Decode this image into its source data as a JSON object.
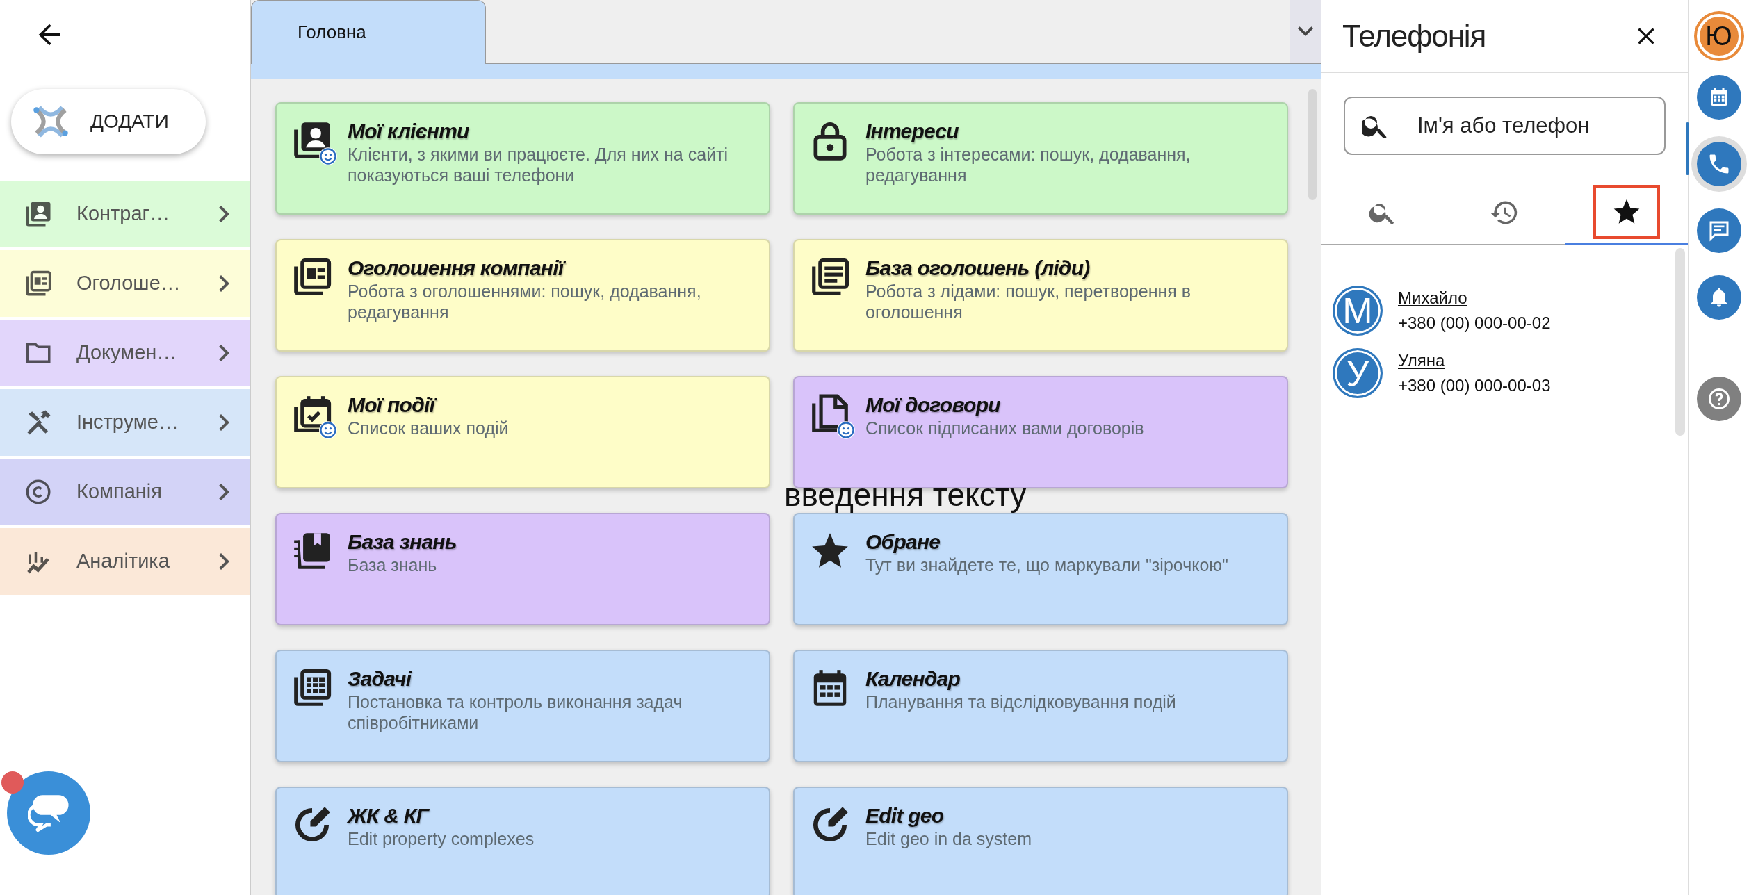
{
  "sidebar": {
    "add_button": "ДОДАТИ",
    "items": [
      {
        "label": "Контраг…",
        "kind": "contacts",
        "color": "#dbfbd8"
      },
      {
        "label": "Оголоше…",
        "kind": "ads",
        "color": "#fdfdd8"
      },
      {
        "label": "Докумен…",
        "kind": "folder",
        "color": "#e2d6fb"
      },
      {
        "label": "Інструме…",
        "kind": "tools",
        "color": "#d6e6f9"
      },
      {
        "label": "Компанія",
        "kind": "copyright",
        "color": "#d3d3f7"
      },
      {
        "label": "Аналітика",
        "kind": "chart",
        "color": "#fbe8d8"
      }
    ]
  },
  "tabs": [
    {
      "label": "Головна",
      "selected": true
    }
  ],
  "cards": [
    {
      "title": "Мої клієнти",
      "description": "Клієнти, з якими ви працюєте. Для них на сайті показуються ваші телефони",
      "kind": "contacts",
      "smiley": true,
      "color": "#ccf8c8"
    },
    {
      "title": "Інтереси",
      "description": "Робота з інтересами: пошук, додавання, редагування",
      "kind": "lock",
      "smiley": false,
      "color": "#ccf8c8"
    },
    {
      "title": "Оголошення компанії",
      "description": "Робота з оголошеннями: пошук, додавання, редагування",
      "kind": "ads",
      "smiley": false,
      "color": "#fefdc8"
    },
    {
      "title": "База оголошень (ліди)",
      "description": "Робота з лідами: пошук, перетворення в оголошення",
      "kind": "list",
      "smiley": false,
      "color": "#fefdc8"
    },
    {
      "title": "Мої події",
      "description": "Список ваших подій",
      "kind": "event",
      "smiley": true,
      "color": "#fefdc8"
    },
    {
      "title": "Мої договори",
      "description": "Список підписаних вами договорів",
      "kind": "document",
      "smiley": true,
      "color": "#d9c3fa"
    },
    {
      "title": "База знань",
      "description": "База знань",
      "kind": "notebook",
      "smiley": false,
      "color": "#d9c3fa"
    },
    {
      "title": "Обране",
      "description": "Тут ви знайдете те, що маркували \"зірочкою\"",
      "kind": "star",
      "smiley": false,
      "color": "#c3ddfa"
    },
    {
      "title": "Задачі",
      "description": "Постановка та контроль виконання задач співробітниками",
      "kind": "tasks",
      "smiley": false,
      "color": "#c3ddfa"
    },
    {
      "title": "Календар",
      "description": "Планування та відслідковування подій",
      "kind": "calendar",
      "smiley": false,
      "color": "#c3ddfa"
    },
    {
      "title": "ЖК & КГ",
      "description": "Edit property complexes",
      "kind": "edit",
      "smiley": false,
      "color": "#c3ddfa"
    },
    {
      "title": "Edit geo",
      "description": "Edit geo in da system",
      "kind": "edit",
      "smiley": false,
      "color": "#c3ddfa"
    }
  ],
  "overlay_text": "введення тексту",
  "telephony": {
    "title": "Телефонія",
    "search": {
      "placeholder": "Ім'я або телефон"
    },
    "tabs": [
      {
        "kind": "search",
        "selected": false
      },
      {
        "kind": "history",
        "selected": false
      },
      {
        "kind": "star",
        "selected": true
      }
    ],
    "contacts": [
      {
        "initial": "М",
        "name": "Михайло",
        "phone": "+380 (00) 000-00-02"
      },
      {
        "initial": "У",
        "name": "Уляна",
        "phone": "+380 (00) 000-00-03"
      }
    ]
  },
  "rail": {
    "avatar": "Ю",
    "items": [
      {
        "kind": "calendar",
        "selected": false
      },
      {
        "kind": "phone",
        "selected": true
      },
      {
        "kind": "chat",
        "selected": false
      },
      {
        "kind": "bell",
        "selected": false
      },
      {
        "kind": "help",
        "selected": false
      }
    ]
  }
}
